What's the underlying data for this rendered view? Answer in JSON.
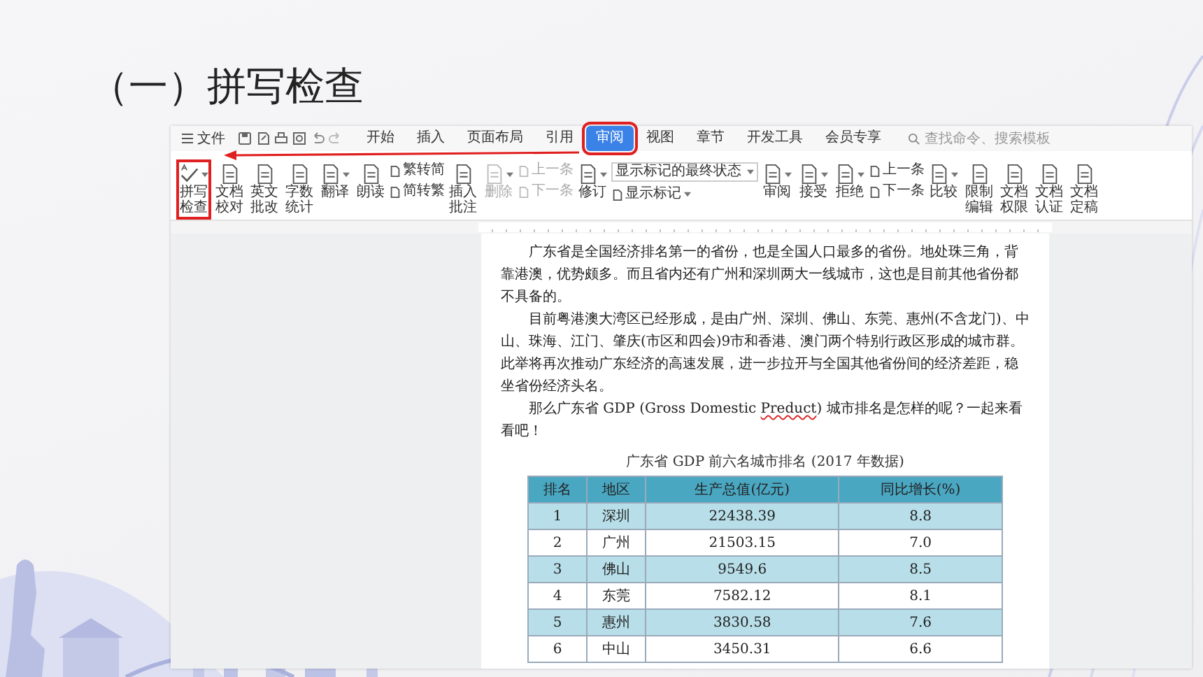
{
  "slide_title": "（一）拼写检查",
  "app": {
    "file_menu": "文件",
    "tabs": [
      {
        "label": "开始",
        "selected": false,
        "highlighted": false
      },
      {
        "label": "插入",
        "selected": false,
        "highlighted": false
      },
      {
        "label": "页面布局",
        "selected": false,
        "highlighted": false
      },
      {
        "label": "引用",
        "selected": false,
        "highlighted": false
      },
      {
        "label": "审阅",
        "selected": true,
        "highlighted": true
      },
      {
        "label": "视图",
        "selected": false,
        "highlighted": false
      },
      {
        "label": "章节",
        "selected": false,
        "highlighted": false
      },
      {
        "label": "开发工具",
        "selected": false,
        "highlighted": false
      },
      {
        "label": "会员专享",
        "selected": false,
        "highlighted": false
      }
    ],
    "search": {
      "placeholder": "查找命令、搜索模板"
    },
    "ribbon": [
      {
        "kind": "large",
        "label": "拼写检查",
        "caret": true,
        "disabled": false,
        "highlighted": true
      },
      {
        "kind": "large",
        "label": "文档校对",
        "caret": false,
        "disabled": false,
        "highlighted": false
      },
      {
        "kind": "large",
        "label": "英文批改",
        "caret": false,
        "disabled": false,
        "highlighted": false
      },
      {
        "kind": "large",
        "label": "字数统计",
        "caret": false,
        "disabled": false,
        "highlighted": false
      },
      {
        "kind": "large",
        "label": "翻译",
        "caret": true,
        "disabled": false,
        "highlighted": false
      },
      {
        "kind": "large",
        "label": "朗读",
        "caret": false,
        "disabled": false,
        "highlighted": false
      },
      {
        "kind": "stack",
        "items": [
          {
            "label": "繁转简",
            "disabled": false
          },
          {
            "label": "简转繁",
            "disabled": false
          }
        ]
      },
      {
        "kind": "large",
        "label": "插入批注",
        "caret": false,
        "disabled": false,
        "highlighted": false
      },
      {
        "kind": "large",
        "label": "删除",
        "caret": true,
        "disabled": true,
        "highlighted": false
      },
      {
        "kind": "stack",
        "items": [
          {
            "label": "上一条",
            "disabled": true
          },
          {
            "label": "下一条",
            "disabled": true
          }
        ]
      },
      {
        "kind": "large",
        "label": "修订",
        "caret": true,
        "disabled": false,
        "highlighted": false
      },
      {
        "kind": "combo",
        "value": "显示标记的最终状态",
        "item": "显示标记"
      },
      {
        "kind": "large",
        "label": "审阅",
        "caret": true,
        "disabled": false,
        "highlighted": false
      },
      {
        "kind": "large",
        "label": "接受",
        "caret": true,
        "disabled": false,
        "highlighted": false
      },
      {
        "kind": "large",
        "label": "拒绝",
        "caret": true,
        "disabled": false,
        "highlighted": false
      },
      {
        "kind": "stack",
        "items": [
          {
            "label": "上一条",
            "disabled": false
          },
          {
            "label": "下一条",
            "disabled": false
          }
        ]
      },
      {
        "kind": "large",
        "label": "比较",
        "caret": true,
        "disabled": false,
        "highlighted": false
      },
      {
        "kind": "large",
        "label": "限制编辑",
        "caret": false,
        "disabled": false,
        "highlighted": false
      },
      {
        "kind": "large",
        "label": "文档权限",
        "caret": false,
        "disabled": false,
        "highlighted": false
      },
      {
        "kind": "large",
        "label": "文档认证",
        "caret": false,
        "disabled": false,
        "highlighted": false
      },
      {
        "kind": "large",
        "label": "文档定稿",
        "caret": false,
        "disabled": false,
        "highlighted": false
      }
    ],
    "document": {
      "paragraphs": [
        [
          {
            "text": "广东省是全国经济排名第一的省份，也是全国人口最多的省份。地处珠三角，背靠港澳，优势颇多。而且省内还有广州和深圳两大一线城市，这也是目前其他省份都不具备的。",
            "misspelled": false
          }
        ],
        [
          {
            "text": "目前粤港澳大湾区已经形成，是由广州、深圳、佛山、东莞、惠州(不含龙门)、中山、珠海、江门、肇庆(市区和四会)9市和香港、澳门两个特别行政区形成的城市群。此举将再次推动广东经济的高速发展，进一步拉开与全国其他省份间的经济差距，稳坐省份经济头名。",
            "misspelled": false
          }
        ],
        [
          {
            "text": "那么广东省 GDP (Gross Domestic ",
            "misspelled": false
          },
          {
            "text": "Preduct",
            "misspelled": true
          },
          {
            "text": ") 城市排名是怎样的呢？一起来看看吧！",
            "misspelled": false
          }
        ]
      ],
      "table_caption": "广东省 GDP 前六名城市排名 (2017 年数据)",
      "table": {
        "columns": [
          "排名",
          "地区",
          "生产总值(亿元)",
          "同比增长(%)"
        ],
        "rows": [
          [
            "1",
            "深圳",
            "22438.39",
            "8.8"
          ],
          [
            "2",
            "广州",
            "21503.15",
            "7.0"
          ],
          [
            "3",
            "佛山",
            "9549.6",
            "8.5"
          ],
          [
            "4",
            "东莞",
            "7582.12",
            "8.1"
          ],
          [
            "5",
            "惠州",
            "3830.58",
            "7.6"
          ],
          [
            "6",
            "中山",
            "3450.31",
            "6.6"
          ]
        ]
      }
    }
  }
}
